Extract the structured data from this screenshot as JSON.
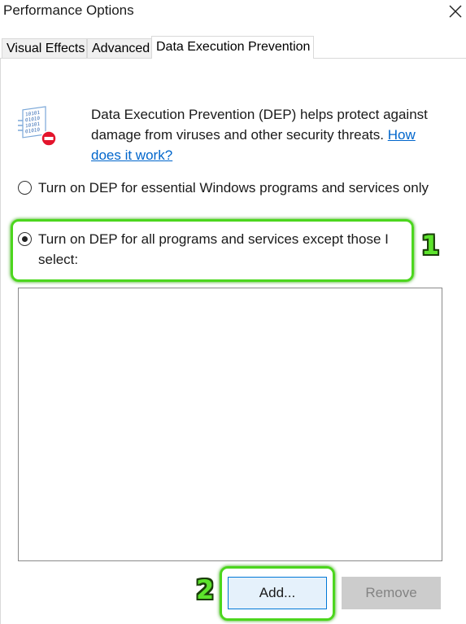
{
  "window": {
    "title": "Performance Options"
  },
  "tabs": [
    {
      "label": "Visual Effects"
    },
    {
      "label": "Advanced"
    },
    {
      "label": "Data Execution Prevention"
    }
  ],
  "description": {
    "text": "Data Execution Prevention (DEP) helps protect against damage from viruses and other security threats.",
    "link": "How does it work?"
  },
  "options": [
    {
      "label": "Turn on DEP for essential Windows programs and services only",
      "selected": false
    },
    {
      "label": "Turn on DEP for all programs and services except those I select:",
      "selected": true
    }
  ],
  "buttons": {
    "add": "Add...",
    "remove": "Remove"
  },
  "annotations": {
    "marker1": "1",
    "marker2": "2",
    "highlight_color": "#4cd61e"
  },
  "icons": {
    "close": "close-icon",
    "dep": "dep-binary-icon"
  }
}
